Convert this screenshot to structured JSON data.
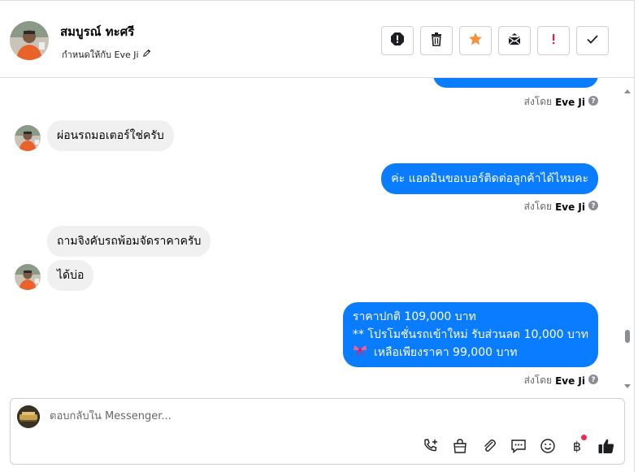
{
  "header": {
    "contact_name": "สมบูรณ์ ทะศรี",
    "assign_text": "กำหนดให้กับ Eve Ji",
    "toolbar": [
      "spam-icon",
      "trash-icon",
      "star-icon",
      "mail-icon",
      "alert-icon",
      "check-icon"
    ],
    "star_color": "#f7923b",
    "alert_color": "#e41e3f"
  },
  "messages": [
    {
      "dir": "out",
      "text": "",
      "sent_by_label": "ส่งโดย",
      "sent_by": "Eve Ji"
    },
    {
      "dir": "in",
      "text": "ผ่อนรถมอเตอร์ใช่ครับ"
    },
    {
      "dir": "out",
      "text": "ค่ะ แอดมินขอเบอร์ติดต่อลูกค้าได้ไหมคะ",
      "sent_by_label": "ส่งโดย",
      "sent_by": "Eve Ji"
    },
    {
      "dir": "in",
      "text": "ถามจิงคับรถพ้อมจัดราคาครับ"
    },
    {
      "dir": "in",
      "text": "ได้บ่อ"
    },
    {
      "dir": "out",
      "lines": [
        "ราคาปกติ 109,000 บาท",
        "** โปรโมชั่นรถเข้าใหม่ รับส่วนลด 10,000 บาท",
        "เหลือเพียงราคา 99,000 บาท"
      ],
      "sent_by_label": "ส่งโดย",
      "sent_by": "Eve Ji"
    }
  ],
  "composer": {
    "placeholder": "ตอบกลับใน Messenger...",
    "icons": [
      "call-icon",
      "shopping-bag-icon",
      "attachment-icon",
      "saved-reply-icon",
      "emoji-icon",
      "baht-icon",
      "like-icon"
    ],
    "baht_symbol": "฿"
  },
  "colors": {
    "outgoing_bubble": "#0a7cff",
    "incoming_bubble": "#f0f0f0"
  }
}
